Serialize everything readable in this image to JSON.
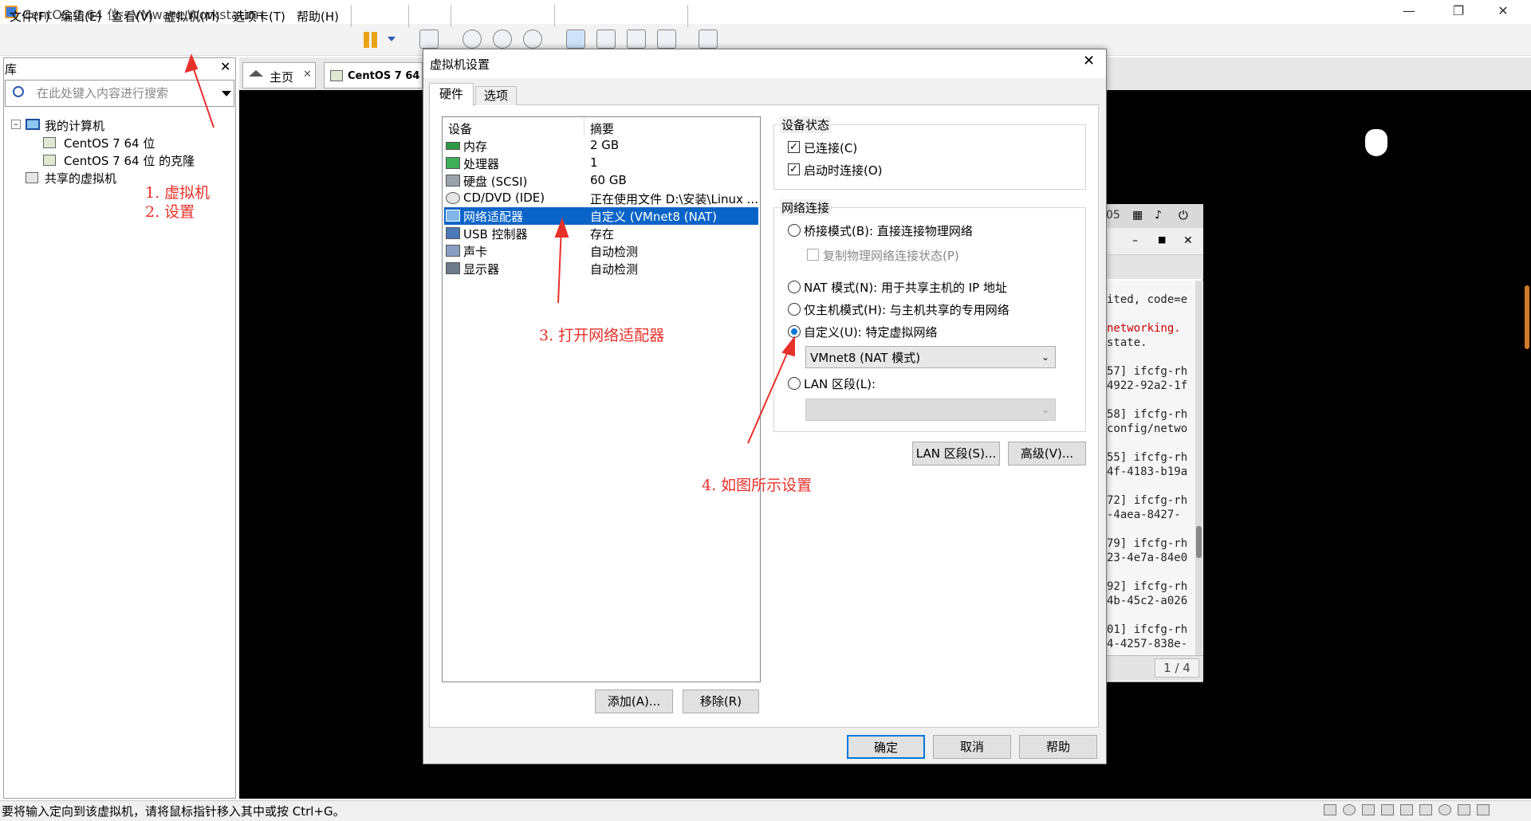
{
  "window": {
    "title": "CentOS 7 64 位 - VMware Workstation"
  },
  "menu": [
    "文件(F)",
    "编辑(E)",
    "查看(V)",
    "虚拟机(M)",
    "选项卡(T)",
    "帮助(H)"
  ],
  "library": {
    "title": "库",
    "search_placeholder": "在此处键入内容进行搜索",
    "tree": {
      "root": "我的计算机",
      "vm1": "CentOS 7 64 位",
      "vm2": "CentOS 7 64 位 的克隆",
      "shared": "共享的虚拟机"
    }
  },
  "tabs": {
    "home": "主页",
    "vm": "CentOS 7 64"
  },
  "annotations": {
    "a1": "1. 虚拟机",
    "a2": "2. 设置",
    "a3": "3. 打开网络适配器",
    "a4": "4. 如图所示设置"
  },
  "dialog": {
    "title": "虚拟机设置",
    "tabs": [
      "硬件",
      "选项"
    ],
    "columns": {
      "device": "设备",
      "summary": "摘要"
    },
    "devices": [
      {
        "name": "内存",
        "summary": "2 GB"
      },
      {
        "name": "处理器",
        "summary": "1"
      },
      {
        "name": "硬盘 (SCSI)",
        "summary": "60 GB"
      },
      {
        "name": "CD/DVD (IDE)",
        "summary": "正在使用文件 D:\\安装\\Linux ..."
      },
      {
        "name": "网络适配器",
        "summary": "自定义 (VMnet8 (NAT)"
      },
      {
        "name": "USB 控制器",
        "summary": "存在"
      },
      {
        "name": "声卡",
        "summary": "自动检测"
      },
      {
        "name": "显示器",
        "summary": "自动检测"
      }
    ],
    "add_button": "添加(A)...",
    "remove_button": "移除(R)",
    "device_status": {
      "label": "设备状态",
      "connected": "已连接(C)",
      "connect_on_start": "启动时连接(O)"
    },
    "network": {
      "label": "网络连接",
      "bridged": "桥接模式(B): 直接连接物理网络",
      "replicate": "复制物理网络连接状态(P)",
      "nat": "NAT 模式(N): 用于共享主机的 IP 地址",
      "hostonly": "仅主机模式(H): 与主机共享的专用网络",
      "custom": "自定义(U): 特定虚拟网络",
      "custom_value": "VMnet8 (NAT 模式)",
      "lan": "LAN 区段(L):"
    },
    "lan_segments_button": "LAN 区段(S)...",
    "advanced_button": "高级(V)...",
    "ok_button": "确定",
    "cancel_button": "取消",
    "help_button": "帮助"
  },
  "guest": {
    "top_fragment": "05",
    "lines": [
      "ited, code=e",
      "networking.",
      "state.",
      "57] ifcfg-rh",
      "4922-92a2-1f",
      "58] ifcfg-rh",
      "config/netwo",
      "55] ifcfg-rh",
      "4f-4183-b19a",
      "72] ifcfg-rh",
      "-4aea-8427-",
      "79] ifcfg-rh",
      "23-4e7a-84e0",
      "92] ifcfg-rh",
      "4b-45c2-a026",
      "01] ifcfg-rh",
      "4-4257-838e-"
    ],
    "page": "1 / 4"
  },
  "status": {
    "text": "要将输入定向到该虚拟机，请将鼠标指针移入其中或按 Ctrl+G。"
  },
  "colors": {
    "selection": "#0a64c8",
    "annotation": "#e8302a",
    "primary_border": "#0078d7"
  }
}
